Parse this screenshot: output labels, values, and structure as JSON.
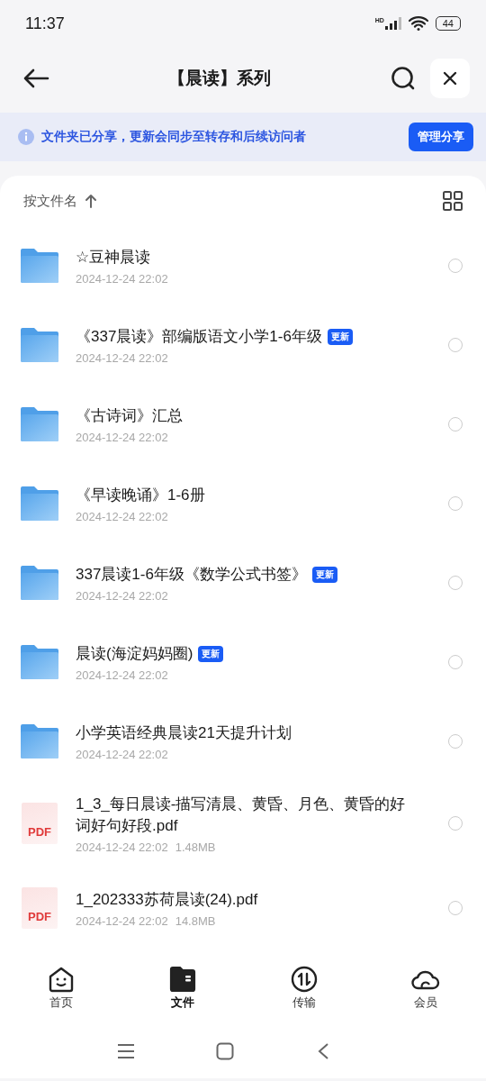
{
  "status_bar": {
    "time": "11:37",
    "network": "HD",
    "battery": "44"
  },
  "header": {
    "title": "【晨读】系列"
  },
  "banner": {
    "text": "文件夹已分享，更新会同步至转存和后续访问者",
    "button": "管理分享"
  },
  "sort": {
    "label": "按文件名"
  },
  "files": [
    {
      "kind": "folder",
      "name": "☆豆神晨读",
      "date": "2024-12-24 22:02",
      "selected": false
    },
    {
      "kind": "folder",
      "name": "《337晨读》部编版语文小学1-6年级",
      "badge": "更新",
      "date": "2024-12-24 22:02",
      "selected": false
    },
    {
      "kind": "folder",
      "name": "《古诗词》汇总",
      "date": "2024-12-24 22:02",
      "selected": false
    },
    {
      "kind": "folder",
      "name": "《早读晚诵》1-6册",
      "date": "2024-12-24 22:02",
      "selected": false
    },
    {
      "kind": "folder",
      "name": "337晨读1-6年级《数学公式书签》",
      "badge": "更新",
      "date": "2024-12-24 22:02",
      "selected": false
    },
    {
      "kind": "folder",
      "name": "晨读(海淀妈妈圈)",
      "badge": "更新",
      "date": "2024-12-24 22:02",
      "selected": false
    },
    {
      "kind": "folder",
      "name": "小学英语经典晨读21天提升计划",
      "date": "2024-12-24 22:02",
      "selected": false
    },
    {
      "kind": "pdf",
      "icon_label": "PDF",
      "name": "1_3_每日晨读-描写清晨、黄昏、月色、黄昏的好词好句好段.pdf",
      "date": "2024-12-24 22:02",
      "size": "1.48MB",
      "selected": false
    },
    {
      "kind": "pdf",
      "icon_label": "PDF",
      "name": "1_202333苏荷晨读(24).pdf",
      "date": "2024-12-24 22:02",
      "size": "14.8MB",
      "selected": false
    }
  ],
  "bottom_nav": [
    {
      "kind": "home",
      "label": "首页",
      "selected": false
    },
    {
      "kind": "files",
      "label": "文件",
      "selected": true
    },
    {
      "kind": "transfer",
      "label": "传输",
      "selected": false
    },
    {
      "kind": "member",
      "label": "会员",
      "selected": false
    }
  ]
}
